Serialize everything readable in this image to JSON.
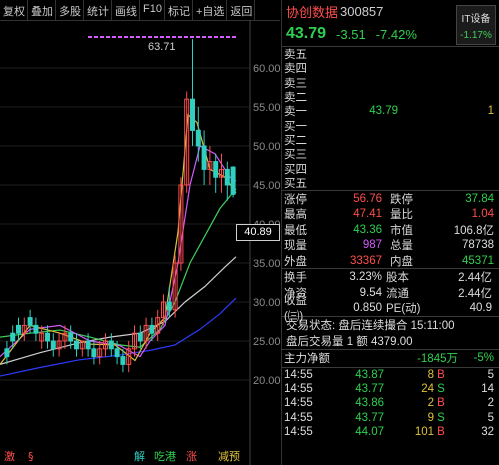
{
  "toolbar": [
    "复权",
    "叠加",
    "多股",
    "统计",
    "画线",
    "F10",
    "标记",
    "+自选",
    "返回"
  ],
  "axis": {
    "labels": [
      "60.00",
      "55.00",
      "50.00",
      "45.00",
      "40.00",
      "35.00",
      "30.00",
      "25.00",
      "20.00"
    ],
    "current_price_box": "40.89",
    "peak_label": "63.71"
  },
  "bottom_markers": [
    "激",
    "§",
    "解",
    "吃港",
    "涨",
    "减预"
  ],
  "stock": {
    "name": "协创数据",
    "code": "300857",
    "sector_name": "IT设备",
    "sector_change": "-1.17%"
  },
  "quote": {
    "price": "43.79",
    "change": "-3.51",
    "pct": "-7.42%"
  },
  "order_book": [
    {
      "label": "卖五",
      "price": "",
      "vol": ""
    },
    {
      "label": "卖四",
      "price": "",
      "vol": ""
    },
    {
      "label": "卖三",
      "price": "",
      "vol": ""
    },
    {
      "label": "卖二",
      "price": "",
      "vol": ""
    },
    {
      "label": "卖一",
      "price": "43.79",
      "vol": "1"
    },
    {
      "label": "买一",
      "price": "",
      "vol": ""
    },
    {
      "label": "买二",
      "price": "",
      "vol": ""
    },
    {
      "label": "买三",
      "price": "",
      "vol": ""
    },
    {
      "label": "买四",
      "price": "",
      "vol": ""
    },
    {
      "label": "买五",
      "price": "",
      "vol": ""
    }
  ],
  "stats": [
    {
      "l": "涨停",
      "v": "56.76",
      "vc": "red",
      "l2": "跌停",
      "v2": "37.84",
      "v2c": "green"
    },
    {
      "l": "最高",
      "v": "47.41",
      "vc": "red",
      "l2": "量比",
      "v2": "1.04",
      "v2c": "red"
    },
    {
      "l": "最低",
      "v": "43.36",
      "vc": "green",
      "l2": "市值",
      "v2": "106.8亿",
      "v2c": "white"
    },
    {
      "l": "现量",
      "v": "987",
      "vc": "purple",
      "l2": "总量",
      "v2": "78738",
      "v2c": "white"
    },
    {
      "l": "外盘",
      "v": "33367",
      "vc": "red",
      "l2": "内盘",
      "v2": "45371",
      "v2c": "green"
    }
  ],
  "stats2": [
    {
      "l": "换手",
      "v": "3.23%",
      "l2": "股本",
      "v2": "2.44亿"
    },
    {
      "l": "净资",
      "v": "9.54",
      "l2": "流通",
      "v2": "2.44亿"
    },
    {
      "l": "收益(㈢)",
      "v": "0.850",
      "l2": "PE(动)",
      "v2": "40.9"
    }
  ],
  "trade_status": "交易状态: 盘后连续撮合 15:11:00",
  "after_hours": "盘后交易量 1 额 4379.00",
  "flow": {
    "label": "主力净额",
    "value": "-1845万",
    "pct": "-5%"
  },
  "ticks": [
    {
      "time": "14:55",
      "price": "43.87",
      "vol": "8",
      "bs": "B",
      "n": "5"
    },
    {
      "time": "14:55",
      "price": "43.77",
      "vol": "24",
      "bs": "S",
      "n": "14"
    },
    {
      "time": "14:55",
      "price": "43.86",
      "vol": "2",
      "bs": "B",
      "n": "2"
    },
    {
      "time": "14:55",
      "price": "43.77",
      "vol": "9",
      "bs": "S",
      "n": "5"
    },
    {
      "time": "14:55",
      "price": "44.07",
      "vol": "101",
      "bs": "B",
      "n": "32"
    }
  ]
}
